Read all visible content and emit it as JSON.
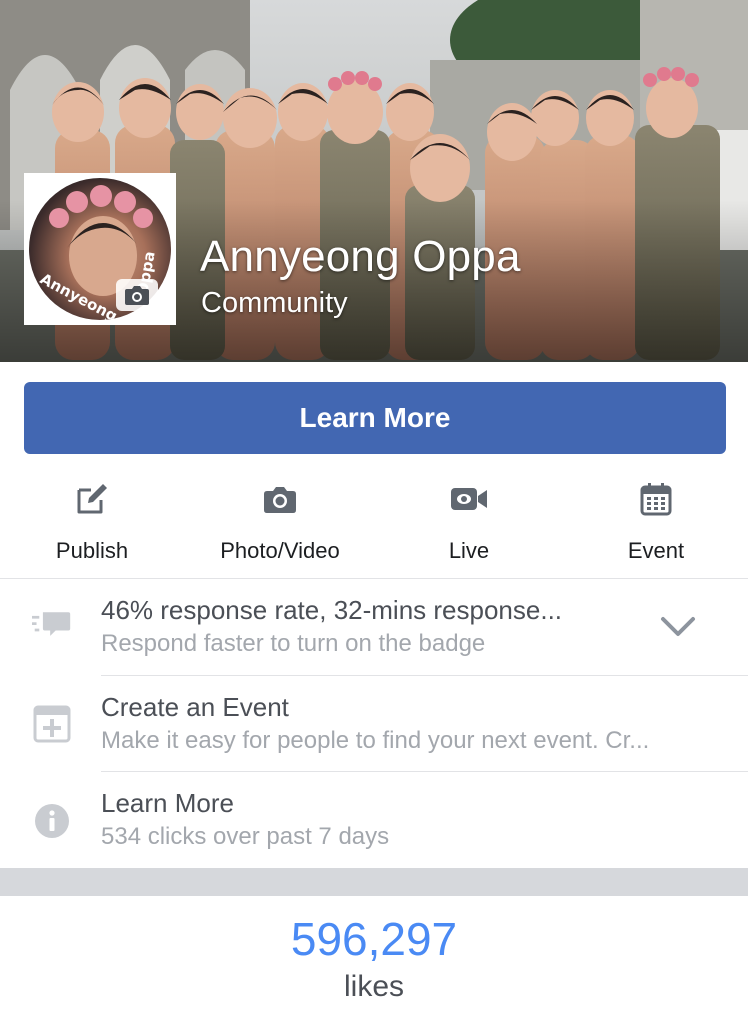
{
  "page": {
    "name": "Annyeong Oppa",
    "category": "Community"
  },
  "profile": {
    "logo_text": "Annyeong Oppa"
  },
  "cta": {
    "label": "Learn More"
  },
  "actions": [
    {
      "label": "Publish",
      "icon": "edit-icon"
    },
    {
      "label": "Photo/Video",
      "icon": "camera-icon"
    },
    {
      "label": "Live",
      "icon": "video-camera-icon"
    },
    {
      "label": "Event",
      "icon": "calendar-icon"
    }
  ],
  "insights": [
    {
      "title": "46% response rate, 32-mins response...",
      "subtitle": "Respond faster to turn on the badge",
      "icon": "chat-bubble-icon"
    },
    {
      "title": "Create an Event",
      "subtitle": "Make it easy for people to find your next event. Cr...",
      "icon": "add-event-icon"
    },
    {
      "title": "Learn More",
      "subtitle": "534 clicks over past 7 days",
      "icon": "info-icon"
    }
  ],
  "likes": {
    "count": "596,297",
    "label": "likes"
  },
  "colors": {
    "brand_blue": "#4267b2",
    "likes_blue": "#4a8af4",
    "icon_gray": "#606770"
  }
}
